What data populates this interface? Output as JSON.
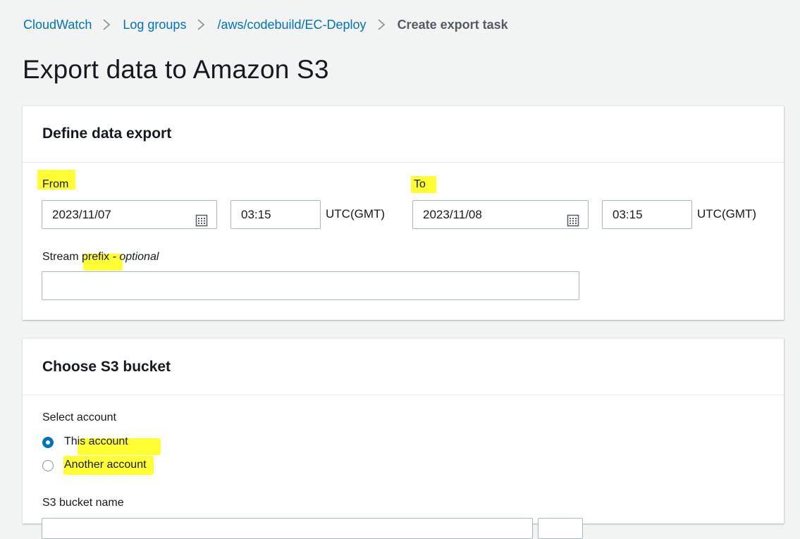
{
  "breadcrumb": {
    "items": [
      "CloudWatch",
      "Log groups",
      "/aws/codebuild/EC-Deploy"
    ],
    "current": "Create export task"
  },
  "page": {
    "title": "Export data to Amazon S3"
  },
  "define_export": {
    "title": "Define data export",
    "from": {
      "label": "From",
      "date": "2023/11/07",
      "time": "03:15",
      "tz": "UTC(GMT)"
    },
    "to": {
      "label": "To",
      "date": "2023/11/08",
      "time": "03:15",
      "tz": "UTC(GMT)"
    },
    "stream_prefix": {
      "label_prefix": "Stream ",
      "label_hl": "prefix",
      "label_optional": " - optional",
      "value": ""
    }
  },
  "choose_bucket": {
    "title": "Choose S3 bucket",
    "select_account_label": "Select account",
    "options": [
      {
        "pre": "Th",
        "hl": "is account",
        "post": "",
        "selected": true
      },
      {
        "pre": "",
        "hl": "Another accou",
        "post": "nt",
        "selected": false
      }
    ],
    "bucket_name_label": "S3 bucket name"
  },
  "icons": {
    "calendar": "calendar-icon",
    "chevron": "chevron-right-icon"
  },
  "colors": {
    "link": "#0073bb",
    "highlight": "#ffff33",
    "radio_selected": "#0073bb"
  }
}
